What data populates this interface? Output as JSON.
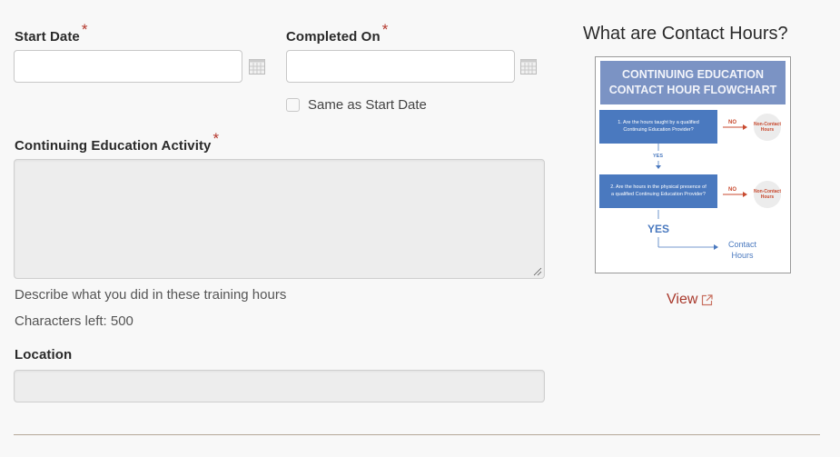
{
  "form": {
    "start_date": {
      "label": "Start Date",
      "required_mark": "*",
      "value": "",
      "icon": "calendar-icon"
    },
    "completed_on": {
      "label": "Completed On",
      "required_mark": "*",
      "value": "",
      "icon": "calendar-icon",
      "same_as_start_label": "Same as Start Date",
      "same_as_start_checked": false
    },
    "activity": {
      "label": "Continuing Education Activity",
      "required_mark": "*",
      "value": "",
      "help_text": "Describe what you did in these training hours",
      "chars_left_text": "Characters left: 500"
    },
    "location": {
      "label": "Location",
      "value": ""
    }
  },
  "sidebar": {
    "title": "What are Contact Hours?",
    "flowchart": {
      "header_line1": "CONTINUING EDUCATION",
      "header_line2": "CONTACT HOUR FLOWCHART",
      "q1": "1. Are the hours taught by a qualified Continuing Education Provider?",
      "q2": "2. Are the hours in the physical presence of a qualified Continuing Education Provider?",
      "no_label": "NO",
      "yes_label": "YES",
      "non_contact": "Non-Contact Hours",
      "contact_line1": "Contact",
      "contact_line2": "Hours"
    },
    "view_link": "View",
    "view_icon": "external-link-icon"
  },
  "colors": {
    "required": "#b5382d",
    "link": "#a8382b",
    "flow_blue": "#4a79bf",
    "flow_header": "#7b93c4",
    "flow_red": "#c84a2f"
  }
}
